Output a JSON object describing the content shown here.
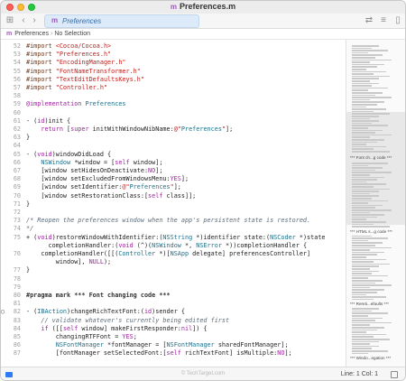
{
  "window": {
    "title": "Preferences.m",
    "file_icon": "m"
  },
  "toolbar": {
    "tab_icon": "m",
    "tab_label": "Preferences",
    "back_icon": "chevron-left-icon",
    "forward_icon": "chevron-right-icon",
    "grid_icon": "grid-icon"
  },
  "breadcrumb": {
    "icon": "m",
    "file": "Preferences",
    "separator": "›",
    "selection": "No Selection"
  },
  "code": {
    "lines": [
      {
        "n": "52",
        "t": "#import <Cocoa/Cocoa.h>"
      },
      {
        "n": "53",
        "t": "#import \"Preferences.h\""
      },
      {
        "n": "54",
        "t": "#import \"EncodingManager.h\""
      },
      {
        "n": "55",
        "t": "#import \"FontNameTransformer.h\""
      },
      {
        "n": "56",
        "t": "#import \"TextEditDefaultsKeys.h\""
      },
      {
        "n": "57",
        "t": "#import \"Controller.h\""
      },
      {
        "n": "58",
        "t": ""
      },
      {
        "n": "59",
        "t": "@implementation Preferences"
      },
      {
        "n": "60",
        "t": ""
      },
      {
        "n": "61",
        "t": "- (id)init {"
      },
      {
        "n": "62",
        "t": "    return [super initWithWindowNibName:@\"Preferences\"];"
      },
      {
        "n": "63",
        "t": "}"
      },
      {
        "n": "64",
        "t": ""
      },
      {
        "n": "65",
        "t": "- (void)windowDidLoad {"
      },
      {
        "n": "66",
        "t": "    NSWindow *window = [self window];"
      },
      {
        "n": "67",
        "t": "    [window setHidesOnDeactivate:NO];"
      },
      {
        "n": "68",
        "t": "    [window setExcludedFromWindowsMenu:YES];"
      },
      {
        "n": "69",
        "t": "    [window setIdentifier:@\"Preferences\"];"
      },
      {
        "n": "70",
        "t": "    [window setRestorationClass:[self class]];"
      },
      {
        "n": "71",
        "t": "}"
      },
      {
        "n": "72",
        "t": ""
      },
      {
        "n": "73",
        "t": "/* Reopen the preferences window when the app's persistent state is restored."
      },
      {
        "n": "74",
        "t": "*/"
      },
      {
        "n": "75",
        "t": "+ (void)restoreWindowWithIdentifier:(NSString *)identifier state:(NSCoder *)state"
      },
      {
        "n": "",
        "t": "      completionHandler:(void (^)(NSWindow *, NSError *))completionHandler {"
      },
      {
        "n": "76",
        "t": "    completionHandler([[(Controller *)[NSApp delegate] preferencesController]"
      },
      {
        "n": "",
        "t": "        window], NULL);"
      },
      {
        "n": "77",
        "t": "}"
      },
      {
        "n": "78",
        "t": ""
      },
      {
        "n": "79",
        "t": ""
      },
      {
        "n": "80",
        "t": "#pragma mark *** Font changing code ***"
      },
      {
        "n": "81",
        "t": ""
      },
      {
        "n": "82",
        "t": "- (IBAction)changeRichTextFont:(id)sender {"
      },
      {
        "n": "83",
        "t": "    // validate whatever's currently being edited first"
      },
      {
        "n": "84",
        "t": "    if ([[self window] makeFirstResponder:nil]) {"
      },
      {
        "n": "85",
        "t": "        changingRTFFont = YES;"
      },
      {
        "n": "86",
        "t": "        NSFontManager *fontManager = [NSFontManager sharedFontManager];"
      },
      {
        "n": "87",
        "t": "        [fontManager setSelectedFont:[self richTextFont] isMultiple:NO];"
      }
    ]
  },
  "minimap": {
    "labels": [
      "*** Font ch...g code ***",
      "*** HTML s...g code ***",
      "*** Rereti...efaults ***",
      "*** Windo...egation ***"
    ]
  },
  "status": {
    "line_col": "Line: 1  Col: 1",
    "watermark": "© TechTarget.com"
  }
}
